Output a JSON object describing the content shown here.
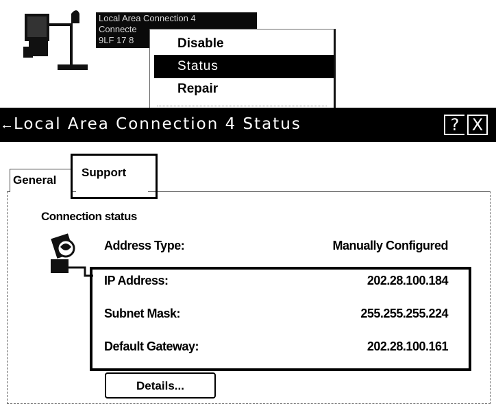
{
  "network_item": {
    "name_lines": [
      "Local Area Connection 4",
      "Connecte",
      "9LF 17 8"
    ]
  },
  "context_menu": {
    "items": [
      {
        "label": "Disable",
        "selected": false
      },
      {
        "label": "Status",
        "selected": true
      },
      {
        "label": "Repair",
        "selected": false
      }
    ]
  },
  "dialog": {
    "title": "Local Area Connection 4 Status",
    "help_label": "?",
    "close_label": "X",
    "tabs": [
      {
        "label": "General",
        "active": false
      },
      {
        "label": "Support",
        "active": true
      }
    ],
    "section_label": "Connection status",
    "rows": [
      {
        "label": "Address Type:",
        "value": "Manually Configured"
      },
      {
        "label": "IP Address:",
        "value": "202.28.100.184"
      },
      {
        "label": "Subnet Mask:",
        "value": "255.255.255.224"
      },
      {
        "label": "Default Gateway:",
        "value": "202.28.100.161"
      }
    ],
    "details_button": "Details..."
  }
}
